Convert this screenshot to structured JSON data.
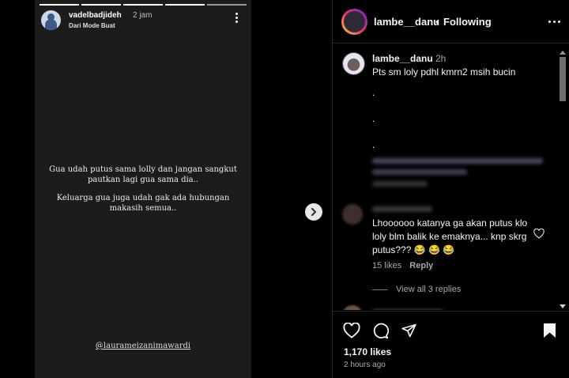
{
  "story": {
    "username": "vadelbadjideh",
    "time": "2 jam",
    "subtitle": "Dari Mode Buat",
    "paragraph_1": "Gua udah putus sama lolly dan jangan sangkut pautkan lagi gua sama dia..",
    "paragraph_2": "Keluarga gua juga udah gak ada hubungan makasih semua..",
    "mention": "@laurameizanimawardi"
  },
  "post": {
    "header": {
      "username": "lambe__danu",
      "separator": "•",
      "follow_status": "Following"
    },
    "caption": {
      "username": "lambe__danu",
      "time": "2h",
      "text": "Pts sm loly pdhl kmrn2 msih bucin",
      "dots": ".\n.\n."
    },
    "comment": {
      "text": "Lhoooooo katanya ga akan putus klo loly blm balik ke emaknya... knp skrg putus??? 😂 😂 😂",
      "likes": "15 likes",
      "reply_label": "Reply",
      "view_replies": "View all 3 replies"
    },
    "likes_count": "1,170 likes",
    "posted_ago": "2 hours ago"
  },
  "icons": {
    "like": "heart-icon",
    "comment": "comment-icon",
    "share": "paper-plane-icon",
    "save": "bookmark-icon",
    "next": "chevron-right-icon",
    "more": "more-dots-icon"
  }
}
